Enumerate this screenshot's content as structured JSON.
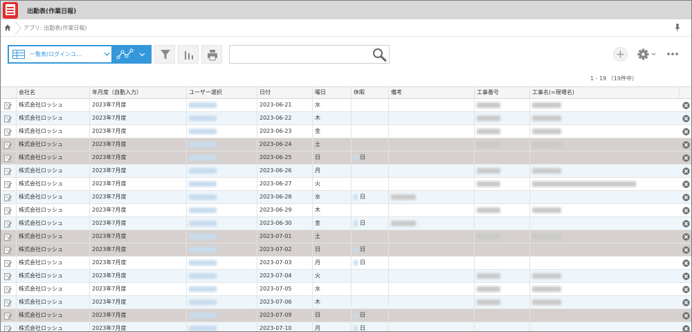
{
  "app": {
    "title": "出勤表(作業日報)",
    "breadcrumb": "アプリ: 出勤表(作業日報)"
  },
  "toolbar": {
    "view_label": "一覧表(ログインユ…",
    "search": {
      "value": "",
      "placeholder": ""
    },
    "pagination": "1 - 19 （19件中）"
  },
  "icons": {
    "home": "home-icon",
    "pin": "pin-icon",
    "table": "table-view-icon",
    "graph": "line-graph-icon",
    "filter": "filter-icon",
    "chart": "bar-chart-icon",
    "print": "printer-icon",
    "search": "search-icon",
    "add": "plus-icon",
    "settings": "gear-icon",
    "more": "more-dots-icon",
    "edit": "edit-record-icon",
    "delete": "delete-record-icon"
  },
  "colors": {
    "accent": "#3498db",
    "app_logo": "#e0302f",
    "row_weekend": "#d6d1ce",
    "row_alt": "#eef6fb",
    "row_base": "#ffffff"
  },
  "table": {
    "columns": [
      "会社名",
      "年月度（自動入力）",
      "ユーザー選択",
      "日付",
      "曜日",
      "休暇",
      "備考",
      "工事番号",
      "工事名(=現場名)"
    ],
    "rows": [
      {
        "company": "株式会社ロッシュ",
        "period": "2023年7月度",
        "date": "2023-06-21",
        "weekday": "水",
        "leave": "",
        "weekend": false
      },
      {
        "company": "株式会社ロッシュ",
        "period": "2023年7月度",
        "date": "2023-06-22",
        "weekday": "木",
        "leave": "",
        "weekend": false
      },
      {
        "company": "株式会社ロッシュ",
        "period": "2023年7月度",
        "date": "2023-06-23",
        "weekday": "金",
        "leave": "",
        "weekend": false
      },
      {
        "company": "株式会社ロッシュ",
        "period": "2023年7月度",
        "date": "2023-06-24",
        "weekday": "土",
        "leave": "",
        "weekend": true
      },
      {
        "company": "株式会社ロッシュ",
        "period": "2023年7月度",
        "date": "2023-06-25",
        "weekday": "日",
        "leave": "日",
        "weekend": true
      },
      {
        "company": "株式会社ロッシュ",
        "period": "2023年7月度",
        "date": "2023-06-26",
        "weekday": "月",
        "leave": "",
        "weekend": false
      },
      {
        "company": "株式会社ロッシュ",
        "period": "2023年7月度",
        "date": "2023-06-27",
        "weekday": "火",
        "leave": "",
        "weekend": false
      },
      {
        "company": "株式会社ロッシュ",
        "period": "2023年7月度",
        "date": "2023-06-28",
        "weekday": "水",
        "leave": "日",
        "weekend": false
      },
      {
        "company": "株式会社ロッシュ",
        "period": "2023年7月度",
        "date": "2023-06-29",
        "weekday": "木",
        "leave": "",
        "weekend": false
      },
      {
        "company": "株式会社ロッシュ",
        "period": "2023年7月度",
        "date": "2023-06-30",
        "weekday": "金",
        "leave": "日",
        "weekend": false
      },
      {
        "company": "株式会社ロッシュ",
        "period": "2023年7月度",
        "date": "2023-07-01",
        "weekday": "土",
        "leave": "",
        "weekend": true
      },
      {
        "company": "株式会社ロッシュ",
        "period": "2023年7月度",
        "date": "2023-07-02",
        "weekday": "日",
        "leave": "日",
        "weekend": true
      },
      {
        "company": "株式会社ロッシュ",
        "period": "2023年7月度",
        "date": "2023-07-03",
        "weekday": "月",
        "leave": "日",
        "weekend": false
      },
      {
        "company": "株式会社ロッシュ",
        "period": "2023年7月度",
        "date": "2023-07-04",
        "weekday": "火",
        "leave": "",
        "weekend": false
      },
      {
        "company": "株式会社ロッシュ",
        "period": "2023年7月度",
        "date": "2023-07-05",
        "weekday": "水",
        "leave": "",
        "weekend": false
      },
      {
        "company": "株式会社ロッシュ",
        "period": "2023年7月度",
        "date": "2023-07-06",
        "weekday": "木",
        "leave": "",
        "weekend": false
      },
      {
        "company": "株式会社ロッシュ",
        "period": "2023年7月度",
        "date": "2023-07-09",
        "weekday": "日",
        "leave": "日",
        "weekend": true
      },
      {
        "company": "株式会社ロッシュ",
        "period": "2023年7月度",
        "date": "2023-07-10",
        "weekday": "月",
        "leave": "日",
        "weekend": false
      }
    ]
  }
}
